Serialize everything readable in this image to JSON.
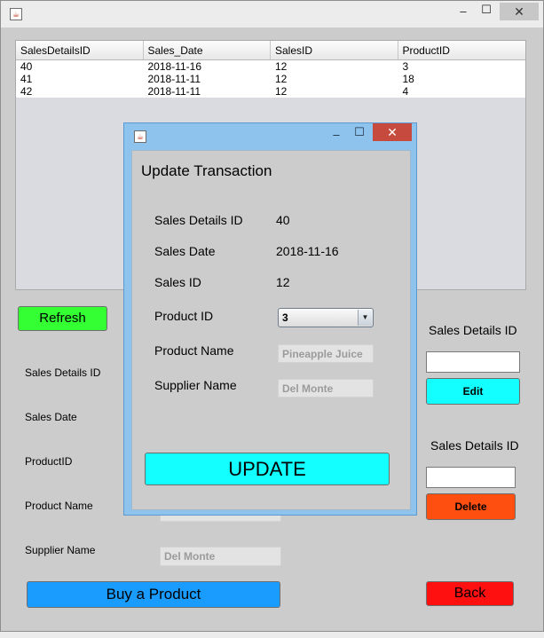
{
  "main_window": {
    "controls": {
      "minimize": "–",
      "maximize": "☐",
      "close": "✕"
    }
  },
  "table": {
    "columns": [
      "SalesDetailsID",
      "Sales_Date",
      "SalesID",
      "ProductID"
    ],
    "rows": [
      [
        "40",
        "2018-11-16",
        "12",
        "3"
      ],
      [
        "41",
        "2018-11-11",
        "12",
        "18"
      ],
      [
        "42",
        "2018-11-11",
        "12",
        "4"
      ]
    ]
  },
  "main_form": {
    "refresh_label": "Refresh",
    "labels": {
      "sales_details_id": "Sales Details ID",
      "sales_date": "Sales Date",
      "product_id": "ProductID",
      "product_name": "Product Name",
      "supplier_name": "Supplier Name"
    },
    "supplier_name_value": "Del Monte",
    "buy_label": "Buy a Product",
    "edit_section": {
      "label": "Sales Details ID",
      "button": "Edit"
    },
    "delete_section": {
      "label": "Sales Details ID",
      "button": "Delete"
    },
    "back_label": "Back"
  },
  "dialog": {
    "controls": {
      "minimize": "–",
      "maximize": "☐",
      "close": "✕"
    },
    "heading": "Update Transaction",
    "labels": {
      "sales_details_id": "Sales Details ID",
      "sales_date": "Sales Date",
      "sales_id": "Sales ID",
      "product_id": "Product ID",
      "product_name": "Product Name",
      "supplier_name": "Supplier Name"
    },
    "values": {
      "sales_details_id": "40",
      "sales_date": "2018-11-16",
      "sales_id": "12",
      "product_id_selected": "3",
      "product_name": "Pineapple Juice",
      "supplier_name": "Del Monte"
    },
    "update_label": "UPDATE"
  },
  "colors": {
    "refresh": "#33ff33",
    "edit": "#13ffff",
    "delete": "#ff4f10",
    "buy": "#1a9cff",
    "back": "#ff1010",
    "update": "#13ffff",
    "dialog_frame": "#8ec3ee"
  }
}
